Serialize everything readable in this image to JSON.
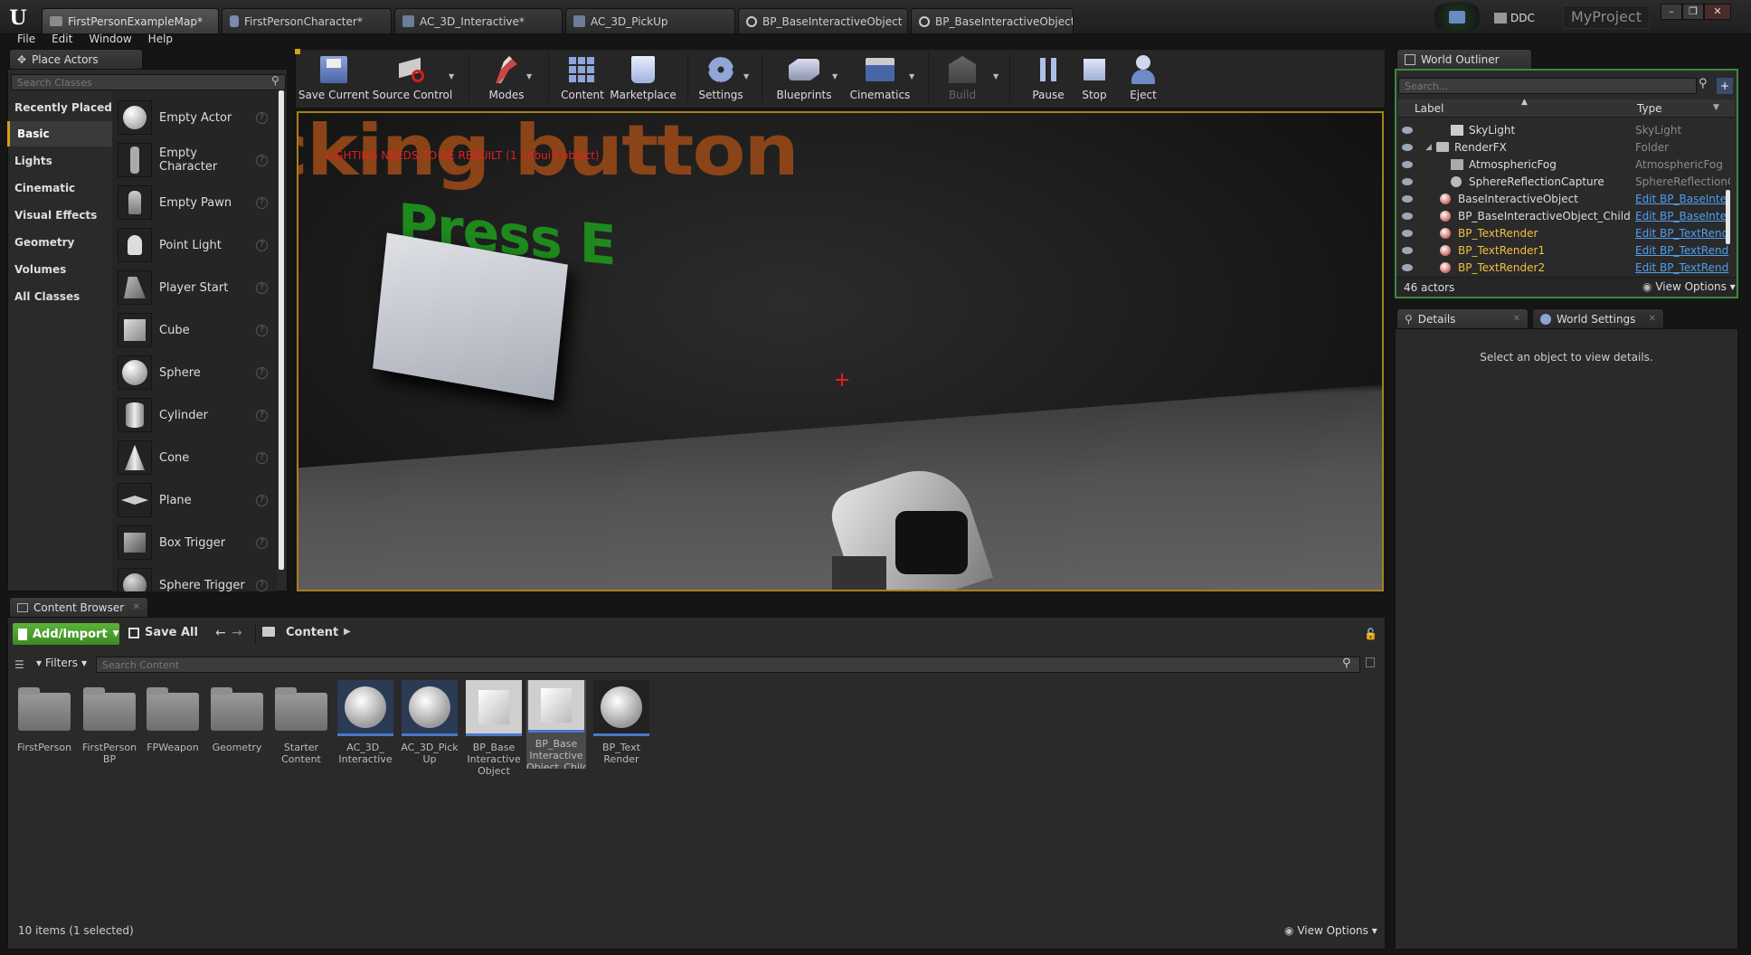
{
  "app": {
    "logo": "U",
    "project": "MyProject",
    "ddc": "DDC"
  },
  "tabs": [
    {
      "label": "FirstPersonExampleMap*",
      "icon": "map-icon"
    },
    {
      "label": "FirstPersonCharacter*",
      "icon": "character-icon"
    },
    {
      "label": "AC_3D_Interactive*",
      "icon": "component-icon"
    },
    {
      "label": "AC_3D_PickUp",
      "icon": "component-icon"
    },
    {
      "label": "BP_BaseInteractiveObject",
      "icon": "blueprint-icon"
    },
    {
      "label": "BP_BaseInteractiveObject",
      "icon": "blueprint-icon"
    }
  ],
  "window_controls": {
    "minimize": "–",
    "restore": "❐",
    "close": "✕"
  },
  "menu": [
    "File",
    "Edit",
    "Window",
    "Help"
  ],
  "place_actors": {
    "tab": "Place Actors",
    "search_placeholder": "Search Classes",
    "categories": [
      "Recently Placed",
      "Basic",
      "Lights",
      "Cinematic",
      "Visual Effects",
      "Geometry",
      "Volumes",
      "All Classes"
    ],
    "selected_category": "Basic",
    "items": [
      "Empty Actor",
      "Empty Character",
      "Empty Pawn",
      "Point Light",
      "Player Start",
      "Cube",
      "Sphere",
      "Cylinder",
      "Cone",
      "Plane",
      "Box Trigger",
      "Sphere Trigger"
    ]
  },
  "toolbar": {
    "save_current": "Save Current",
    "source_control": "Source Control",
    "modes": "Modes",
    "content": "Content",
    "marketplace": "Marketplace",
    "settings": "Settings",
    "blueprints": "Blueprints",
    "cinematics": "Cinematics",
    "build": "Build",
    "pause": "Pause",
    "stop": "Stop",
    "eject": "Eject"
  },
  "viewport": {
    "warning": "LIGHTING NEEDS TO BE REBUILT (1 unbuilt object)",
    "scene_text_top": "cking button",
    "scene_text_press": "Press E"
  },
  "world_outliner": {
    "tab": "World Outliner",
    "search_placeholder": "Search...",
    "col_label": "Label",
    "col_type": "Type",
    "rows": [
      {
        "label": "SkyLight",
        "type": "SkyLight",
        "link": false
      },
      {
        "label": "RenderFX",
        "type": "Folder",
        "link": false
      },
      {
        "label": "AtmosphericFog",
        "type": "AtmosphericFog",
        "link": false
      },
      {
        "label": "SphereReflectionCapture",
        "type": "SphereReflectionC",
        "link": false
      },
      {
        "label": "BaseInteractiveObject",
        "type": "Edit BP_BaseInte",
        "link": true
      },
      {
        "label": "BP_BaseInteractiveObject_Child",
        "type": "Edit BP_BaseInte",
        "link": true
      },
      {
        "label": "BP_TextRender",
        "type": "Edit BP_TextRend",
        "link": true
      },
      {
        "label": "BP_TextRender1",
        "type": "Edit BP_TextRend",
        "link": true
      },
      {
        "label": "BP_TextRender2",
        "type": "Edit BP_TextRend",
        "link": true
      }
    ],
    "actor_count": "46 actors",
    "view_options": "View Options"
  },
  "details": {
    "tab": "Details",
    "world_settings_tab": "World Settings",
    "empty_message": "Select an object to view details."
  },
  "content_browser": {
    "tab": "Content Browser",
    "add_import": "Add/Import",
    "save_all": "Save All",
    "path": "Content",
    "filters": "Filters",
    "search_placeholder": "Search Content",
    "assets": [
      {
        "name": "FirstPerson",
        "kind": "folder"
      },
      {
        "name": "FirstPerson BP",
        "kind": "folder"
      },
      {
        "name": "FPWeapon",
        "kind": "folder"
      },
      {
        "name": "Geometry",
        "kind": "folder"
      },
      {
        "name": "Starter Content",
        "kind": "folder"
      },
      {
        "name": "AC_3D_ Interactive",
        "kind": "component"
      },
      {
        "name": "AC_3D_Pick Up",
        "kind": "component"
      },
      {
        "name": "BP_Base Interactive Object",
        "kind": "blueprint"
      },
      {
        "name": "BP_Base Interactive Object_Child",
        "kind": "blueprint-selected"
      },
      {
        "name": "BP_Text Render",
        "kind": "sphere"
      }
    ],
    "status": "10 items (1 selected)",
    "view_options": "View Options"
  },
  "colors": {
    "accent": "#d49f1a",
    "link": "#4f9eec",
    "add_button": "#4da02f",
    "warning": "#e02020"
  }
}
